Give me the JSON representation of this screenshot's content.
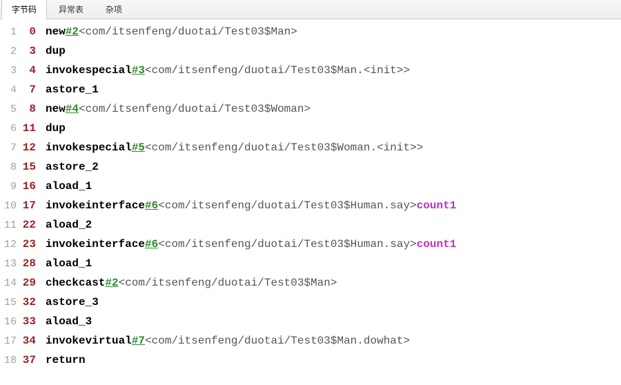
{
  "tabs": [
    {
      "label": "字节码",
      "active": true
    },
    {
      "label": "异常表",
      "active": false
    },
    {
      "label": "杂项",
      "active": false
    }
  ],
  "lines": [
    {
      "n": 1,
      "off": "0",
      "op": "new",
      "ref": "#2",
      "desc": "<com/itsenfeng/duotai/Test03$Man>"
    },
    {
      "n": 2,
      "off": "3",
      "op": "dup"
    },
    {
      "n": 3,
      "off": "4",
      "op": "invokespecial",
      "ref": "#3",
      "desc": "<com/itsenfeng/duotai/Test03$Man.<init>>"
    },
    {
      "n": 4,
      "off": "7",
      "op": "astore_1"
    },
    {
      "n": 5,
      "off": "8",
      "op": "new",
      "ref": "#4",
      "desc": "<com/itsenfeng/duotai/Test03$Woman>"
    },
    {
      "n": 6,
      "off": "11",
      "op": "dup"
    },
    {
      "n": 7,
      "off": "12",
      "op": "invokespecial",
      "ref": "#5",
      "desc": "<com/itsenfeng/duotai/Test03$Woman.<init>>"
    },
    {
      "n": 8,
      "off": "15",
      "op": "astore_2"
    },
    {
      "n": 9,
      "off": "16",
      "op": "aload_1"
    },
    {
      "n": 10,
      "off": "17",
      "op": "invokeinterface",
      "ref": "#6",
      "desc": "<com/itsenfeng/duotai/Test03$Human.say>",
      "count_kw": "count",
      "count_n": "1"
    },
    {
      "n": 11,
      "off": "22",
      "op": "aload_2"
    },
    {
      "n": 12,
      "off": "23",
      "op": "invokeinterface",
      "ref": "#6",
      "desc": "<com/itsenfeng/duotai/Test03$Human.say>",
      "count_kw": "count",
      "count_n": "1"
    },
    {
      "n": 13,
      "off": "28",
      "op": "aload_1"
    },
    {
      "n": 14,
      "off": "29",
      "op": "checkcast",
      "ref": "#2",
      "desc": "<com/itsenfeng/duotai/Test03$Man>"
    },
    {
      "n": 15,
      "off": "32",
      "op": "astore_3"
    },
    {
      "n": 16,
      "off": "33",
      "op": "aload_3"
    },
    {
      "n": 17,
      "off": "34",
      "op": "invokevirtual",
      "ref": "#7",
      "desc": "<com/itsenfeng/duotai/Test03$Man.dowhat>"
    },
    {
      "n": 18,
      "off": "37",
      "op": "return"
    }
  ]
}
